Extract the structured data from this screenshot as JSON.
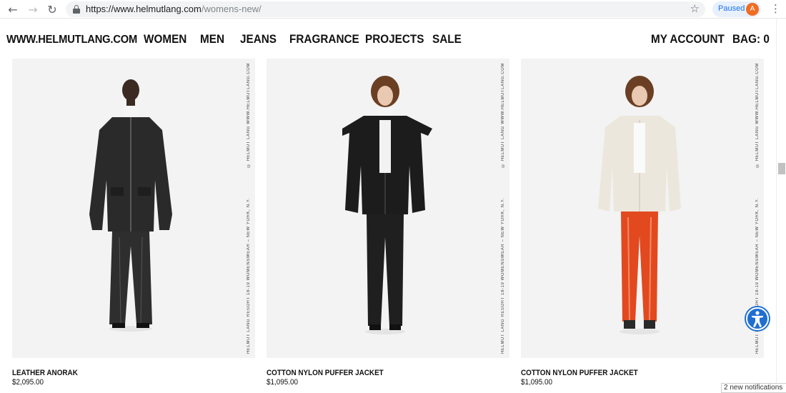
{
  "browser": {
    "url_host": "https://www.helmutlang.com",
    "url_path": "/womens-new/",
    "profile_status": "Paused",
    "profile_initial": "A",
    "notification": "2 new notifications"
  },
  "header": {
    "logo": "WWW.HELMUTLANG.COM",
    "nav": [
      "WOMEN",
      "MEN",
      "JEANS",
      "FRAGRANCE",
      "PROJECTS",
      "SALE"
    ],
    "account": "MY ACCOUNT",
    "bag": "BAG: 0"
  },
  "products": [
    {
      "name": "LEATHER ANORAK",
      "price": "$2,095.00",
      "credit_top": "© HELMUT LANG    WWW.HELMUTLANG.COM",
      "credit_bottom": "HELMUT LANG RESORT 18-19 WOMENSWEAR – NEW YORK, N.Y."
    },
    {
      "name": "COTTON NYLON PUFFER JACKET",
      "price": "$1,095.00",
      "credit_top": "© HELMUT LANG    WWW.HELMUTLANG.COM",
      "credit_bottom": "HELMUT LANG RESORT 18-19 WOMENSWEAR – NEW YORK, N.Y."
    },
    {
      "name": "COTTON NYLON PUFFER JACKET",
      "price": "$1,095.00",
      "credit_top": "© HELMUT LANG    WWW.HELMUTLANG.COM",
      "credit_bottom": "HELMUT LANG RESORT 18-19 WOMENSWEAR – NEW YORK, N.Y."
    }
  ],
  "colors": {
    "accent_blue": "#1f6fd1",
    "leather": "#2a2a2a",
    "puffer_black": "#1c1c1c",
    "puffer_cream": "#ece7dc",
    "vinyl_orange": "#e2491f"
  }
}
